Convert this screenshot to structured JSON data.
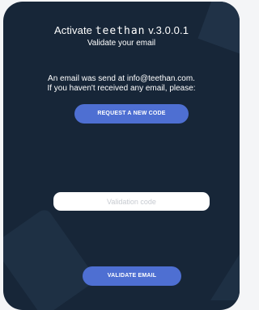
{
  "header": {
    "activate": "Activate",
    "brand": "teethan",
    "version": "v.3.0.0.1",
    "subtitle": "Validate your email"
  },
  "message": {
    "line1": "An email was send at info@teethan.com.",
    "line2": "If you haven't received any email, please:"
  },
  "buttons": {
    "request_code": "REQUEST A NEW CODE",
    "validate_email": "VALIDATE EMAIL"
  },
  "form": {
    "code_placeholder": "Validation code",
    "code_value": ""
  },
  "colors": {
    "card_bg": "#172638",
    "button_bg": "#4e6fd2",
    "page_bg": "#f4f5f7"
  }
}
